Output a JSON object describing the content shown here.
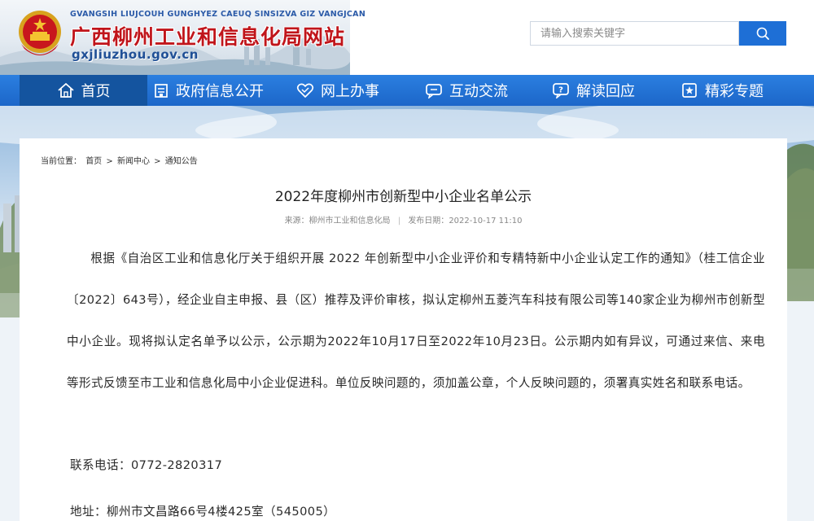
{
  "header": {
    "pinyin": "GVANGSIH LIUJCOUH GUNGHYEZ CAEUQ SINSIZVA GIZ VANGJCAN",
    "title": "广西柳州工业和信息化局网站",
    "domain": "gxjliuzhou.gov.cn",
    "search_placeholder": "请输入搜索关键字"
  },
  "nav": {
    "items": [
      {
        "label": "首页",
        "icon": "home-icon"
      },
      {
        "label": "政府信息公开",
        "icon": "building-icon"
      },
      {
        "label": "网上办事",
        "icon": "handshake-icon"
      },
      {
        "label": "互动交流",
        "icon": "chat-icon"
      },
      {
        "label": "解读回应",
        "icon": "question-bubble-icon"
      },
      {
        "label": "精彩专题",
        "icon": "star-doc-icon"
      }
    ]
  },
  "breadcrumb": {
    "prefix": "当前位置：",
    "items": [
      "首页",
      "新闻中心",
      "通知公告"
    ],
    "separator": ">"
  },
  "article": {
    "title": "2022年度柳州市创新型中小企业名单公示",
    "source_label": "来源：",
    "source": "柳州市工业和信息化局",
    "date_label": "发布日期：",
    "date": "2022-10-17 11:10",
    "body": "根据《自治区工业和信息化厅关于组织开展 2022 年创新型中小企业评价和专精特新中小企业认定工作的通知》（桂工信企业〔2022〕643号），经企业自主申报、县（区）推荐及评价审核，拟认定柳州五菱汽车科技有限公司等140家企业为柳州市创新型中小企业。现将拟认定名单予以公示，公示期为2022年10月17日至2022年10月23日。公示期内如有异议，可通过来信、来电等形式反馈至市工业和信息化局中小企业促进科。单位反映问题的，须加盖公章，个人反映问题的，须署真实姓名和联系电话。",
    "phone_line": "联系电话：0772-2820317",
    "address_line": "地址：柳州市文昌路66号4楼425室（545005）"
  },
  "colors": {
    "nav_bg": "#1c66c9",
    "nav_active": "#14549f",
    "title_red": "#c0151b",
    "search_button": "#1e6fd6"
  }
}
